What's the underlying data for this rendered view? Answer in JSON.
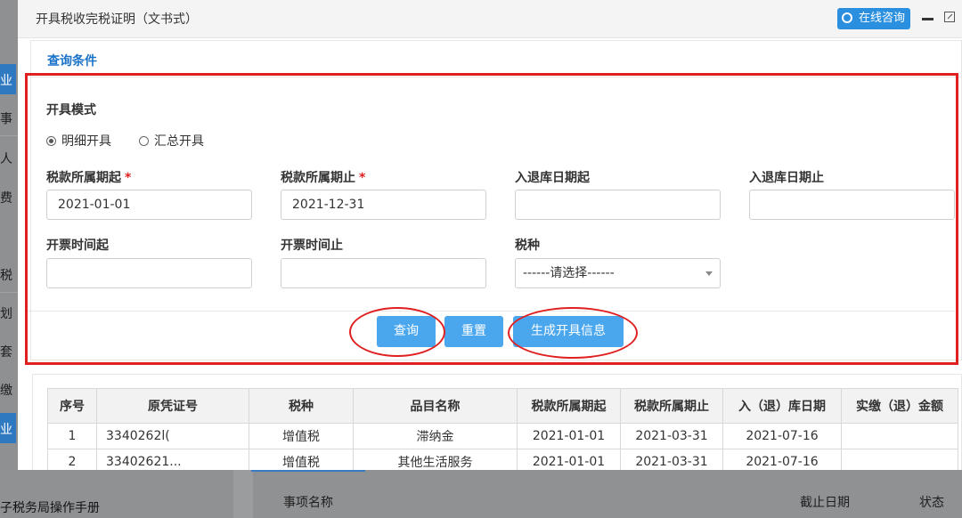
{
  "background": {
    "left_items": [
      "业",
      "事",
      "人",
      "费",
      "税",
      "划",
      "套",
      "缴",
      "业"
    ],
    "bottom_manual": "子税务局操作手册",
    "bottom_columns": [
      "事项名称",
      "截止日期",
      "状态"
    ]
  },
  "dialog": {
    "title": "开具税收完税证明（文书式）",
    "online_label": "在线咨询"
  },
  "query": {
    "section_title": "查询条件",
    "mode_label": "开具模式",
    "radios": [
      {
        "label": "明细开具",
        "checked": true
      },
      {
        "label": "汇总开具",
        "checked": false
      }
    ],
    "fields": {
      "tax_period_start": {
        "label": "税款所属期起",
        "required": "*",
        "value": "2021-01-01"
      },
      "tax_period_end": {
        "label": "税款所属期止",
        "required": "*",
        "value": "2021-12-31"
      },
      "storage_date_start": {
        "label": "入退库日期起",
        "value": ""
      },
      "storage_date_end": {
        "label": "入退库日期止",
        "value": ""
      },
      "invoice_time_start": {
        "label": "开票时间起",
        "value": ""
      },
      "invoice_time_end": {
        "label": "开票时间止",
        "value": ""
      },
      "tax_type": {
        "label": "税种",
        "selected": "------请选择------"
      }
    },
    "buttons": {
      "query": "查询",
      "reset": "重置",
      "generate": "生成开具信息"
    }
  },
  "table": {
    "headers": [
      "序号",
      "原凭证号",
      "税种",
      "品目名称",
      "税款所属期起",
      "税款所属期止",
      "入（退）库日期",
      "实缴（退）金额"
    ],
    "rows": [
      [
        "1",
        "3340262l(",
        "增值税",
        "滞纳金",
        "2021-01-01",
        "2021-03-31",
        "2021-07-16",
        ""
      ],
      [
        "2",
        "33402621...",
        "增值税",
        "其他生活服务",
        "2021-01-01",
        "2021-03-31",
        "2021-07-16",
        ""
      ]
    ]
  },
  "colors": {
    "accent": "#1a73c9",
    "button": "#4aa7ee",
    "annotation": "#e02020"
  }
}
